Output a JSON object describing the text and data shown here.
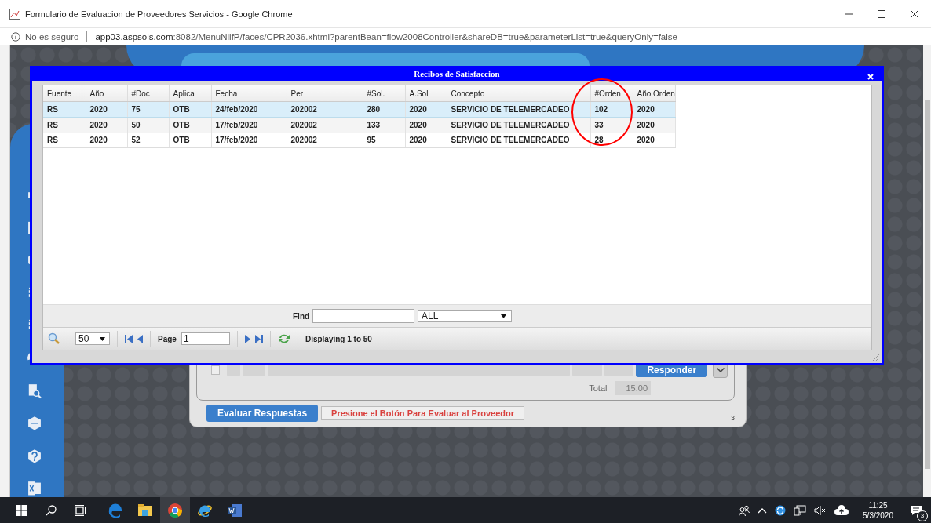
{
  "window": {
    "title": "Formulario de Evaluacion de Proveedores Servicios - Google Chrome"
  },
  "address_bar": {
    "security": "No es seguro",
    "host": "app03.aspsols.com",
    "path": ":8082/MenuNiifP/faces/CPR2036.xhtml?parentBean=flow2008Controller&shareDB=true&parameterList=true&queryOnly=false"
  },
  "dialog": {
    "title": "Recibos de Satisfaccion",
    "columns": [
      "Fuente",
      "Año",
      "#Doc",
      "Aplica",
      "Fecha",
      "Per",
      "#Sol.",
      "A.Sol",
      "Concepto",
      "#Orden",
      "Año Orden"
    ],
    "rows": [
      {
        "cells": [
          "RS",
          "2020",
          "75",
          "OTB",
          "24/feb/2020",
          "202002",
          "280",
          "2020",
          "SERVICIO DE TELEMERCADEO",
          "102",
          "2020"
        ],
        "selected": true
      },
      {
        "cells": [
          "RS",
          "2020",
          "50",
          "OTB",
          "17/feb/2020",
          "202002",
          "133",
          "2020",
          "SERVICIO DE TELEMERCADEO",
          "33",
          "2020"
        ],
        "selected": false
      },
      {
        "cells": [
          "RS",
          "2020",
          "52",
          "OTB",
          "17/feb/2020",
          "202002",
          "95",
          "2020",
          "SERVICIO DE TELEMERCADEO",
          "28",
          "2020"
        ],
        "selected": false
      }
    ],
    "find": {
      "label": "Find",
      "filter": "ALL"
    },
    "pager": {
      "page_size": "50",
      "page_label": "Page",
      "page": "1",
      "status": "Displaying 1 to 50"
    }
  },
  "form": {
    "checkbox_checked": false,
    "respond_button": "Responder",
    "total_label": "Total",
    "total": "15.00",
    "evaluate_button": "Evaluar Respuestas",
    "message": "Presione el Botón Para Evaluar al Proveedor",
    "page_number": "3"
  },
  "taskbar": {
    "apps": [
      {
        "kind": "edge",
        "selected": false
      },
      {
        "kind": "explorer",
        "selected": false
      },
      {
        "kind": "chrome",
        "selected": true
      },
      {
        "kind": "ie",
        "selected": false
      },
      {
        "kind": "word",
        "selected": false
      }
    ],
    "time": "11:25",
    "date": "5/3/2020",
    "notifications": "3"
  }
}
